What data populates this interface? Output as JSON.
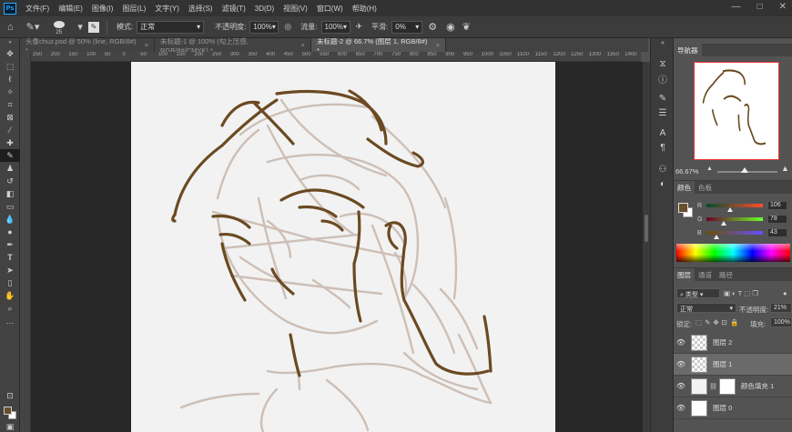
{
  "app": {
    "logo": "Ps"
  },
  "menu": [
    "文件(F)",
    "编辑(E)",
    "图像(I)",
    "图层(L)",
    "文字(Y)",
    "选择(S)",
    "滤镜(T)",
    "3D(D)",
    "视图(V)",
    "窗口(W)",
    "帮助(H)"
  ],
  "window_controls": {
    "minimize": "—",
    "maximize": "□",
    "close": "✕"
  },
  "options": {
    "brush_size": "25",
    "mode_label": "模式:",
    "mode_value": "正常",
    "opacity_label": "不透明度:",
    "opacity_value": "100%",
    "flow_label": "流量:",
    "flow_value": "100%",
    "smoothing_label": "平滑:",
    "smoothing_value": "0%"
  },
  "tabs": [
    {
      "label": "头像chuz.psd @ 50% (line, RGB/8#) *",
      "close": "×"
    },
    {
      "label": "未标题-1 @ 100% (勾上压感, RGB/8#/CMYK) *",
      "close": "×"
    },
    {
      "label": "未标题-2 @ 66.7% (图层 1, RGB/8#) *",
      "close": "×"
    }
  ],
  "ruler_h": [
    "250",
    "200",
    "150",
    "100",
    "50",
    "0",
    "50",
    "100",
    "150",
    "200",
    "250",
    "300",
    "350",
    "400",
    "450",
    "500",
    "550",
    "600",
    "650",
    "700",
    "750",
    "800",
    "850",
    "900",
    "950",
    "1000",
    "1050",
    "1100",
    "1150",
    "1200",
    "1250",
    "1300",
    "1350",
    "1400"
  ],
  "navigator": {
    "tab_label": "导航器",
    "zoom": "66.67%"
  },
  "color_panel": {
    "tabs": [
      "颜色",
      "色板"
    ],
    "channels": [
      {
        "label": "R",
        "value": "106",
        "fraction": 0.416
      },
      {
        "label": "G",
        "value": "78",
        "fraction": 0.306
      },
      {
        "label": "B",
        "value": "43",
        "fraction": 0.169
      }
    ],
    "foreground": "#6a4e2b",
    "background": "#ffffff"
  },
  "layers_panel": {
    "tabs": [
      "图层",
      "通道",
      "路径"
    ],
    "kind_label": "类型",
    "blend_mode": "正常",
    "opacity_label": "不透明度:",
    "opacity_value": "21%",
    "lock_label": "锁定:",
    "fill_label": "填充:",
    "fill_value": "100%",
    "layers": [
      {
        "name": "图层 2",
        "selected": false
      },
      {
        "name": "图层 1",
        "selected": true
      },
      {
        "name": "颜色填充 1",
        "selected": false
      },
      {
        "name": "图层 0",
        "selected": false
      }
    ]
  },
  "colors": {
    "sketch_dark": "#6b4a22",
    "sketch_light": "#cdbfb6",
    "canvas": "#f2f2f2"
  }
}
